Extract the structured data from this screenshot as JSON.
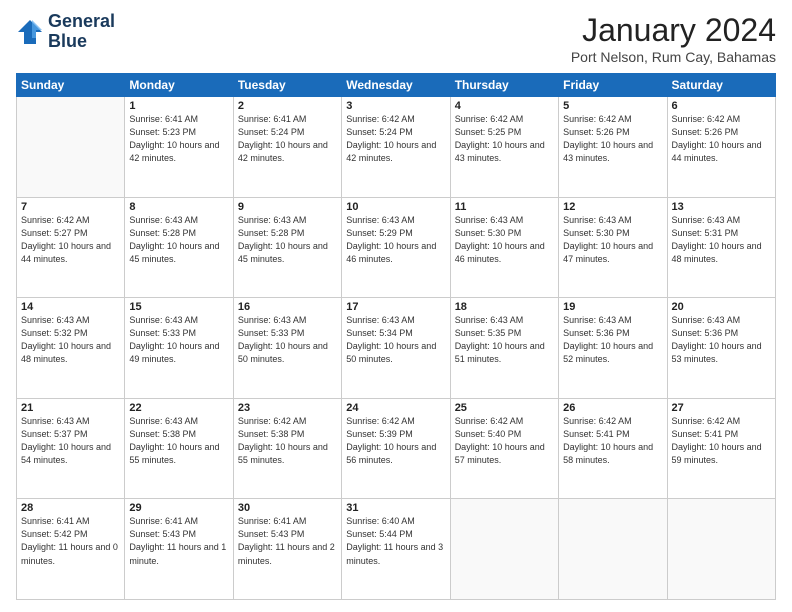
{
  "header": {
    "logo_line1": "General",
    "logo_line2": "Blue",
    "month_title": "January 2024",
    "location": "Port Nelson, Rum Cay, Bahamas"
  },
  "weekdays": [
    "Sunday",
    "Monday",
    "Tuesday",
    "Wednesday",
    "Thursday",
    "Friday",
    "Saturday"
  ],
  "weeks": [
    [
      {
        "day": "",
        "info": ""
      },
      {
        "day": "1",
        "info": "Sunrise: 6:41 AM\nSunset: 5:23 PM\nDaylight: 10 hours\nand 42 minutes."
      },
      {
        "day": "2",
        "info": "Sunrise: 6:41 AM\nSunset: 5:24 PM\nDaylight: 10 hours\nand 42 minutes."
      },
      {
        "day": "3",
        "info": "Sunrise: 6:42 AM\nSunset: 5:24 PM\nDaylight: 10 hours\nand 42 minutes."
      },
      {
        "day": "4",
        "info": "Sunrise: 6:42 AM\nSunset: 5:25 PM\nDaylight: 10 hours\nand 43 minutes."
      },
      {
        "day": "5",
        "info": "Sunrise: 6:42 AM\nSunset: 5:26 PM\nDaylight: 10 hours\nand 43 minutes."
      },
      {
        "day": "6",
        "info": "Sunrise: 6:42 AM\nSunset: 5:26 PM\nDaylight: 10 hours\nand 44 minutes."
      }
    ],
    [
      {
        "day": "7",
        "info": "Sunrise: 6:42 AM\nSunset: 5:27 PM\nDaylight: 10 hours\nand 44 minutes."
      },
      {
        "day": "8",
        "info": "Sunrise: 6:43 AM\nSunset: 5:28 PM\nDaylight: 10 hours\nand 45 minutes."
      },
      {
        "day": "9",
        "info": "Sunrise: 6:43 AM\nSunset: 5:28 PM\nDaylight: 10 hours\nand 45 minutes."
      },
      {
        "day": "10",
        "info": "Sunrise: 6:43 AM\nSunset: 5:29 PM\nDaylight: 10 hours\nand 46 minutes."
      },
      {
        "day": "11",
        "info": "Sunrise: 6:43 AM\nSunset: 5:30 PM\nDaylight: 10 hours\nand 46 minutes."
      },
      {
        "day": "12",
        "info": "Sunrise: 6:43 AM\nSunset: 5:30 PM\nDaylight: 10 hours\nand 47 minutes."
      },
      {
        "day": "13",
        "info": "Sunrise: 6:43 AM\nSunset: 5:31 PM\nDaylight: 10 hours\nand 48 minutes."
      }
    ],
    [
      {
        "day": "14",
        "info": "Sunrise: 6:43 AM\nSunset: 5:32 PM\nDaylight: 10 hours\nand 48 minutes."
      },
      {
        "day": "15",
        "info": "Sunrise: 6:43 AM\nSunset: 5:33 PM\nDaylight: 10 hours\nand 49 minutes."
      },
      {
        "day": "16",
        "info": "Sunrise: 6:43 AM\nSunset: 5:33 PM\nDaylight: 10 hours\nand 50 minutes."
      },
      {
        "day": "17",
        "info": "Sunrise: 6:43 AM\nSunset: 5:34 PM\nDaylight: 10 hours\nand 50 minutes."
      },
      {
        "day": "18",
        "info": "Sunrise: 6:43 AM\nSunset: 5:35 PM\nDaylight: 10 hours\nand 51 minutes."
      },
      {
        "day": "19",
        "info": "Sunrise: 6:43 AM\nSunset: 5:36 PM\nDaylight: 10 hours\nand 52 minutes."
      },
      {
        "day": "20",
        "info": "Sunrise: 6:43 AM\nSunset: 5:36 PM\nDaylight: 10 hours\nand 53 minutes."
      }
    ],
    [
      {
        "day": "21",
        "info": "Sunrise: 6:43 AM\nSunset: 5:37 PM\nDaylight: 10 hours\nand 54 minutes."
      },
      {
        "day": "22",
        "info": "Sunrise: 6:43 AM\nSunset: 5:38 PM\nDaylight: 10 hours\nand 55 minutes."
      },
      {
        "day": "23",
        "info": "Sunrise: 6:42 AM\nSunset: 5:38 PM\nDaylight: 10 hours\nand 55 minutes."
      },
      {
        "day": "24",
        "info": "Sunrise: 6:42 AM\nSunset: 5:39 PM\nDaylight: 10 hours\nand 56 minutes."
      },
      {
        "day": "25",
        "info": "Sunrise: 6:42 AM\nSunset: 5:40 PM\nDaylight: 10 hours\nand 57 minutes."
      },
      {
        "day": "26",
        "info": "Sunrise: 6:42 AM\nSunset: 5:41 PM\nDaylight: 10 hours\nand 58 minutes."
      },
      {
        "day": "27",
        "info": "Sunrise: 6:42 AM\nSunset: 5:41 PM\nDaylight: 10 hours\nand 59 minutes."
      }
    ],
    [
      {
        "day": "28",
        "info": "Sunrise: 6:41 AM\nSunset: 5:42 PM\nDaylight: 11 hours\nand 0 minutes."
      },
      {
        "day": "29",
        "info": "Sunrise: 6:41 AM\nSunset: 5:43 PM\nDaylight: 11 hours\nand 1 minute."
      },
      {
        "day": "30",
        "info": "Sunrise: 6:41 AM\nSunset: 5:43 PM\nDaylight: 11 hours\nand 2 minutes."
      },
      {
        "day": "31",
        "info": "Sunrise: 6:40 AM\nSunset: 5:44 PM\nDaylight: 11 hours\nand 3 minutes."
      },
      {
        "day": "",
        "info": ""
      },
      {
        "day": "",
        "info": ""
      },
      {
        "day": "",
        "info": ""
      }
    ]
  ]
}
